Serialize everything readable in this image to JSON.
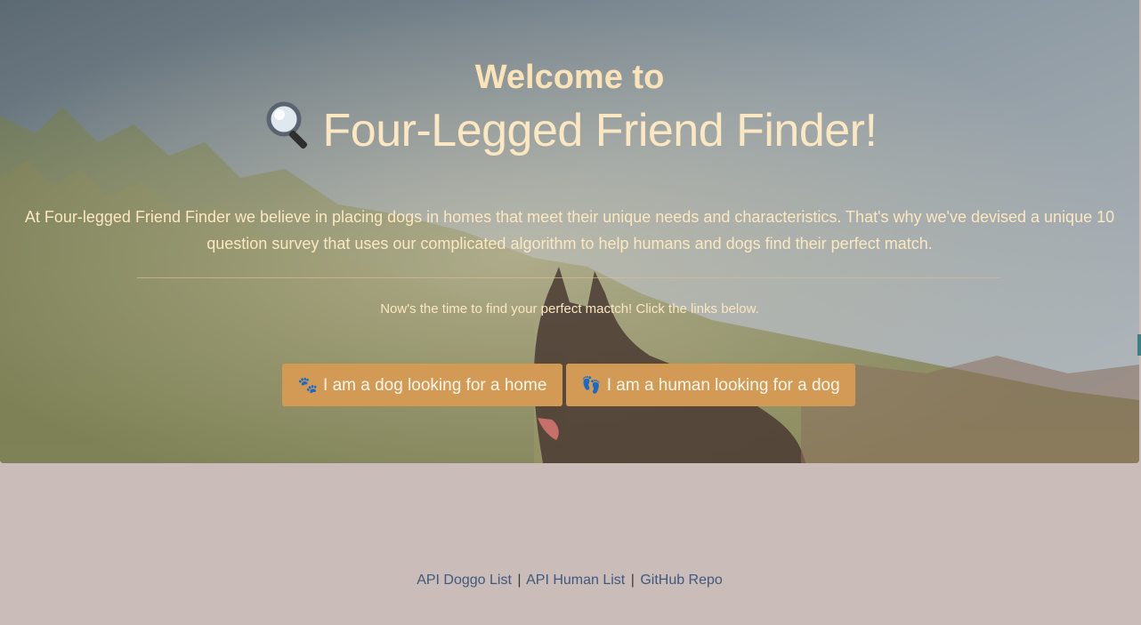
{
  "hero": {
    "welcome": "Welcome to",
    "title": "Four-Legged Friend Finder!",
    "title_icon": "magnifying-glass-icon",
    "lead": "At Four-legged Friend Finder we believe in placing dogs in homes that meet their unique needs and characteristics. That's why we've devised a unique 10 question survey that uses our complicated algorithm to help humans and dogs find their perfect match.",
    "cta_text": "Now's the time to find your perfect mactch! Click the links below.",
    "buttons": [
      {
        "label": "I am a dog looking for a home",
        "icon": "paw-prints-icon"
      },
      {
        "label": "I am a human looking for a dog",
        "icon": "footprints-icon"
      }
    ]
  },
  "footer": {
    "links": [
      "API Doggo List",
      "API Human List",
      "GitHub Repo"
    ],
    "separator": "|"
  },
  "colors": {
    "button": "#d39a56",
    "heading_text": "#fbe7c1",
    "page_background": "#c9bcb9",
    "footer_link": "#41597c"
  }
}
